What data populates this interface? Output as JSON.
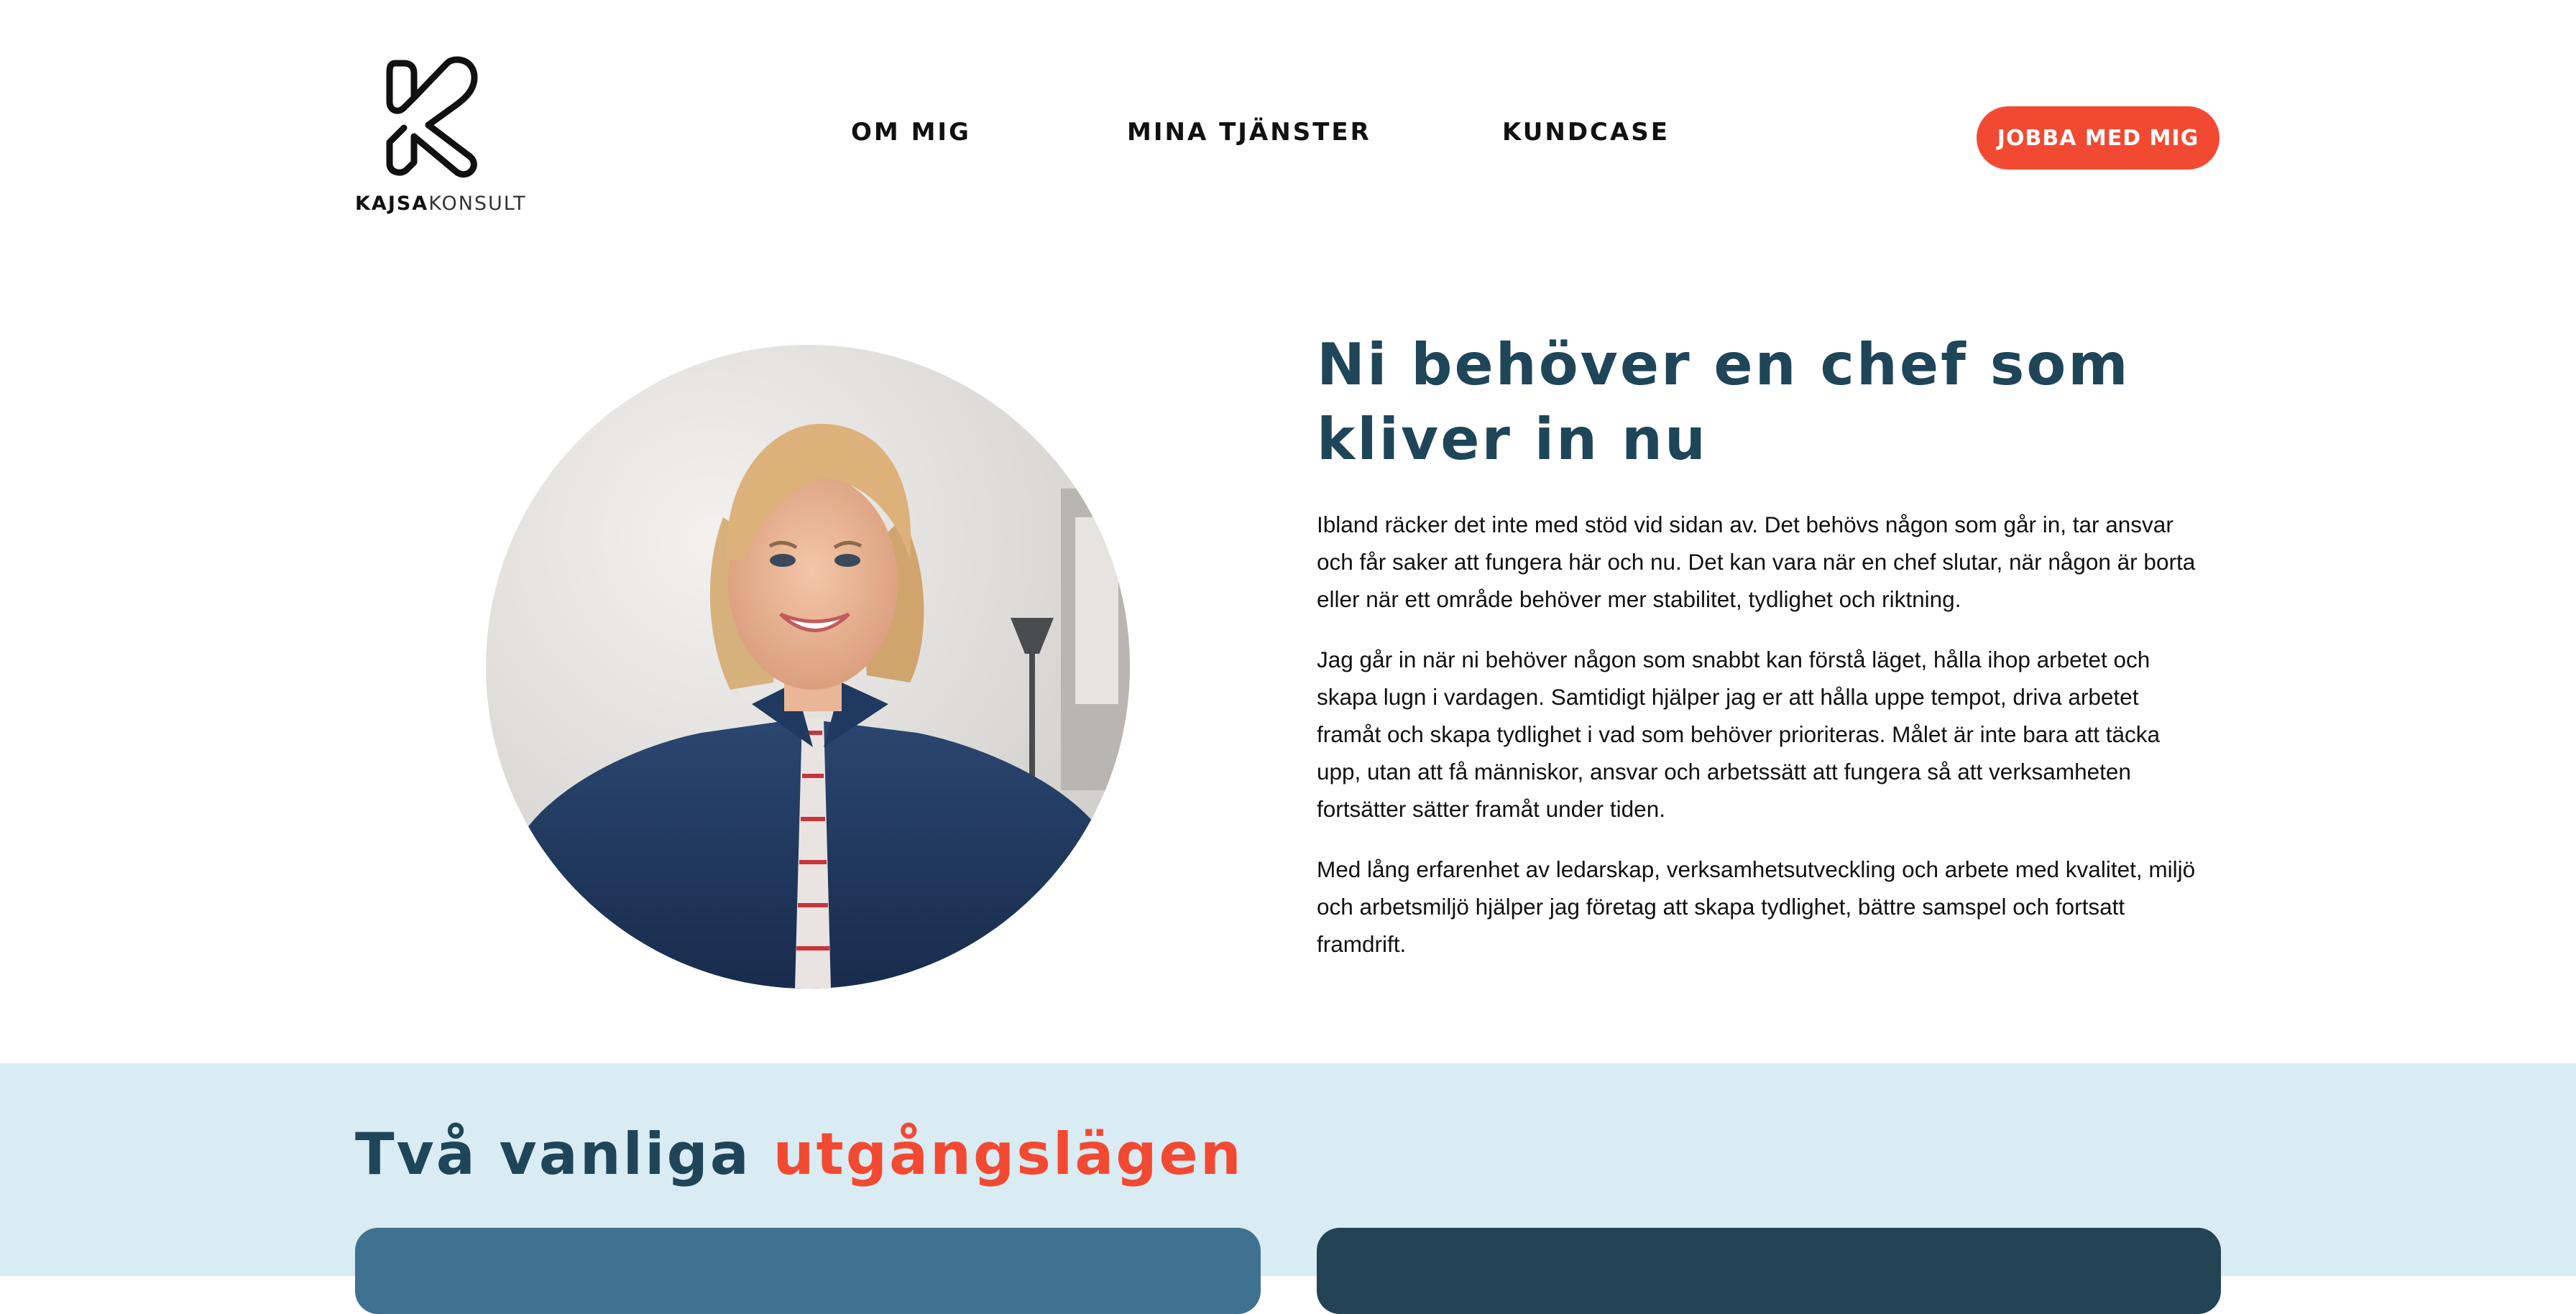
{
  "brand": {
    "logo_bold": "KAJSA",
    "logo_light": "KONSULT"
  },
  "nav": {
    "items": [
      {
        "label": "OM MIG"
      },
      {
        "label": "MINA TJÄNSTER"
      },
      {
        "label": "KUNDCASE"
      }
    ],
    "cta_label": "JOBBA MED MIG"
  },
  "hero": {
    "title": "Ni behöver en chef som kliver in nu",
    "paragraphs": [
      "Ibland räcker det inte med stöd vid sidan av. Det behövs någon som går in, tar ansvar och får saker att fungera här och nu. Det kan vara när en chef slutar, när någon är borta eller när ett område behöver mer stabilitet, tydlighet och riktning.",
      "Jag går in när ni behöver någon som snabbt kan förstå läget, hålla ihop arbetet och skapa lugn i vardagen. Samtidigt hjälper jag er att hålla uppe tempot, driva arbetet framåt och skapa tydlighet i vad som behöver prioriteras. Målet är inte bara att täcka upp, utan att få människor, ansvar och arbetssätt att fungera så att verksamheten fortsätter sätter framåt under tiden.",
      "Med lång erfarenhet av ledarskap, verksamhetsutveckling och arbete med kvalitet, miljö och arbetsmiljö hjälper jag företag att skapa tydlighet, bättre samspel och fortsatt framdrift."
    ]
  },
  "section2": {
    "title_part1": "Två vanliga ",
    "title_accent": "utgångslägen"
  },
  "colors": {
    "accent": "#f24a32",
    "heading": "#1f4559",
    "section_bg": "#d9ebf3",
    "card_left": "#3e7290",
    "card_right": "#234454"
  }
}
